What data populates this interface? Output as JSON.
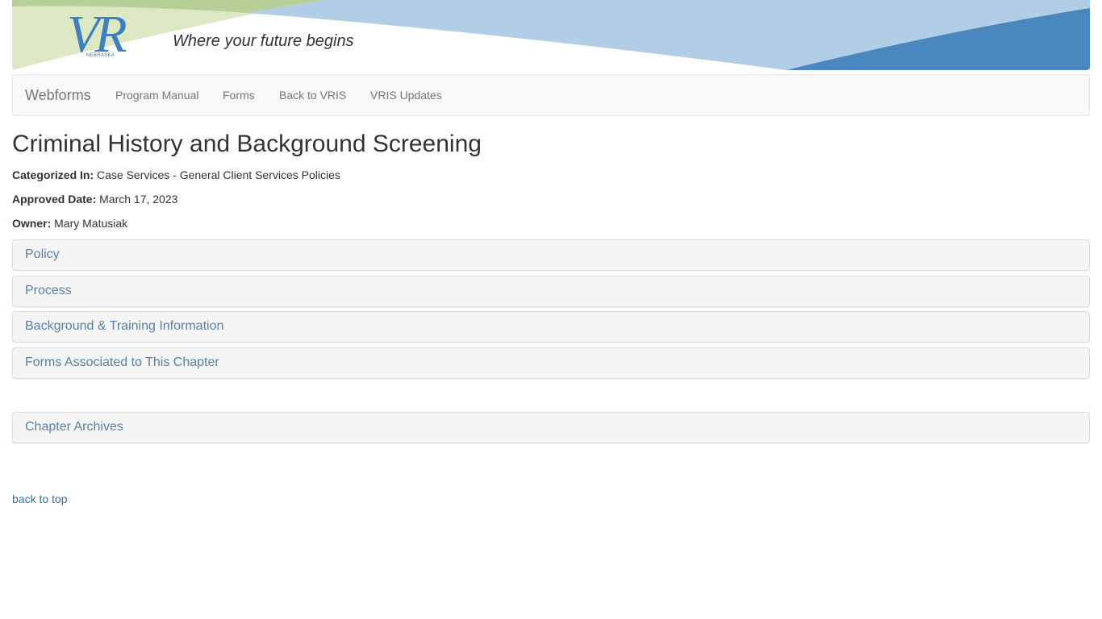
{
  "header": {
    "logo_text": "VR",
    "logo_state": "NEBRASKA",
    "tagline": "Where your future begins",
    "colors": {
      "green_light": "#dce8c4",
      "green": "#b6cf96",
      "blue_light": "#b2cde6",
      "blue_dark": "#4a87bf"
    }
  },
  "navbar": {
    "brand": "Webforms",
    "items": [
      {
        "label": "Program Manual"
      },
      {
        "label": "Forms"
      },
      {
        "label": "Back to VRIS"
      },
      {
        "label": "VRIS Updates"
      }
    ]
  },
  "page": {
    "title": "Criminal History and Background Screening",
    "categorized_label": "Categorized In:",
    "categorized_value": "Case Services - General Client Services Policies",
    "approved_label": "Approved Date:",
    "approved_value": "March 17, 2023",
    "owner_label": "Owner:",
    "owner_value": "Mary Matusiak"
  },
  "panels": [
    {
      "label": "Policy"
    },
    {
      "label": "Process"
    },
    {
      "label": "Background & Training Information"
    },
    {
      "label": "Forms Associated to This Chapter"
    }
  ],
  "archives": {
    "label": "Chapter Archives"
  },
  "footer": {
    "back_to_top": "back to top"
  }
}
